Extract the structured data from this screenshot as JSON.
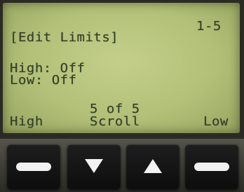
{
  "screen": {
    "page_indicator": "1-5",
    "title": "[Edit Limits]",
    "high_line": "High: Off",
    "low_line": "Low: Off",
    "counter": "5 of 5"
  },
  "softkeys": {
    "left": "High",
    "center": "Scroll",
    "right": "Low"
  },
  "keypad": {
    "keys": [
      {
        "icon": "dash-icon"
      },
      {
        "icon": "arrow-down-icon"
      },
      {
        "icon": "arrow-up-icon"
      },
      {
        "icon": "dash-icon"
      }
    ]
  },
  "colors": {
    "lcd_background": "#b3c078",
    "lcd_text": "#34402a",
    "key_color": "#111111",
    "key_symbol": "#f2f2f2"
  }
}
